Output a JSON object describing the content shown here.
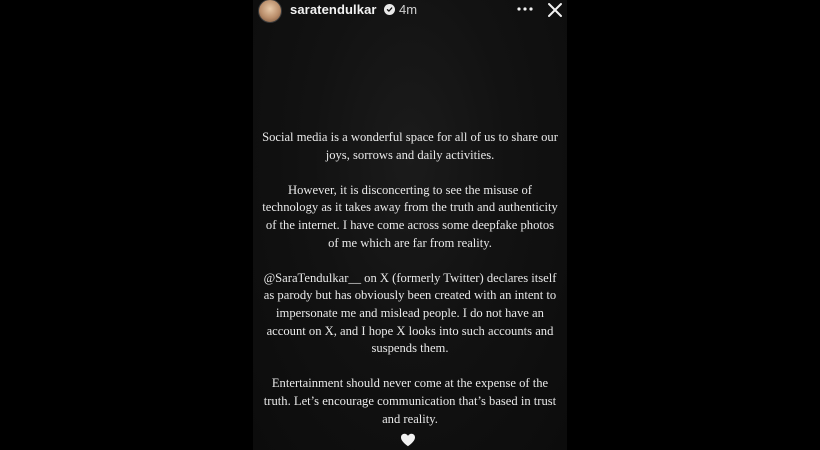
{
  "story": {
    "username": "saratendulkar",
    "time": "4m",
    "verified": true,
    "icons": {
      "avatar": "profile-avatar",
      "verified": "verified-badge-icon",
      "more": "more-options-icon",
      "close": "close-icon",
      "heart": "heart-icon"
    },
    "paragraphs": [
      "Social media is a wonderful space for all of us to share our joys, sorrows and daily activities.",
      "However, it is disconcerting to see the misuse of technology as it takes away from the truth and authenticity of the internet. I have come across some deepfake photos of me which are far from reality.",
      "@SaraTendulkar__ on X (formerly Twitter) declares itself as parody but has obviously been created with an intent to impersonate me and mislead people. I do not have an account on X, and I hope X looks into such accounts and suspends them.",
      "Entertainment should never come at the expense of the truth. Let’s encourage communication that’s based in trust and reality."
    ]
  }
}
